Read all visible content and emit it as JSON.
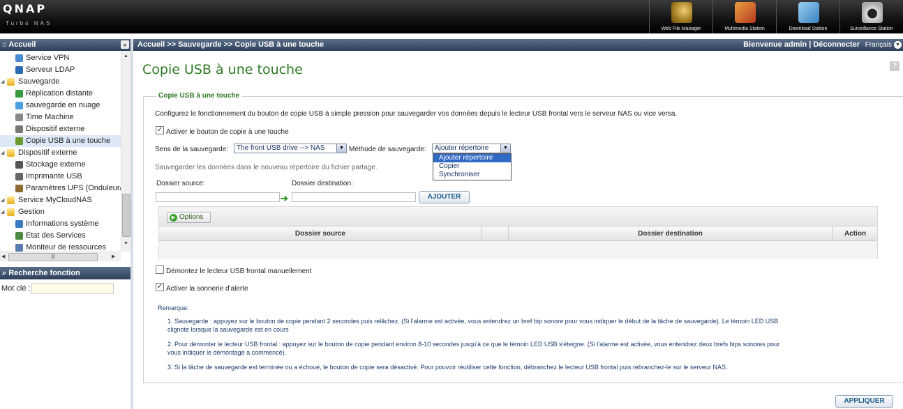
{
  "header": {
    "logo": "QNAP",
    "logo_sub": "Turbo NAS",
    "apps": [
      {
        "label": "Web File Manager",
        "icon": "web-file-manager-icon"
      },
      {
        "label": "Multimedia Station",
        "icon": "multimedia-station-icon"
      },
      {
        "label": "Download Station",
        "icon": "download-station-icon"
      },
      {
        "label": "Surveillance Station",
        "icon": "surveillance-station-icon"
      }
    ]
  },
  "sidebar": {
    "title": "Accueil",
    "collapse_glyph": "«",
    "items": [
      {
        "label": "Service VPN",
        "level": 2
      },
      {
        "label": "Serveur LDAP",
        "level": 2
      },
      {
        "label": "Sauvegarde",
        "level": 1
      },
      {
        "label": "Réplication distante",
        "level": 2
      },
      {
        "label": "sauvegarde en nuage",
        "level": 2
      },
      {
        "label": "Time Machine",
        "level": 2
      },
      {
        "label": "Dispositif externe",
        "level": 2
      },
      {
        "label": "Copie USB à une touche",
        "level": 2,
        "selected": true
      },
      {
        "label": "Dispositif externe",
        "level": 1
      },
      {
        "label": "Stockage externe",
        "level": 2
      },
      {
        "label": "Imprimante USB",
        "level": 2
      },
      {
        "label": "Paramètres UPS (Onduleur/A",
        "level": 2
      },
      {
        "label": "Service MyCloudNAS",
        "level": 1
      },
      {
        "label": "Gestion",
        "level": 1
      },
      {
        "label": "Informations système",
        "level": 2
      },
      {
        "label": "Etat des Services",
        "level": 2
      },
      {
        "label": "Moniteur de ressources",
        "level": 2
      }
    ],
    "search_title": "Recherche fonction",
    "search_label": "Mot clé :",
    "search_value": ""
  },
  "crumb": {
    "path": "Accueil >> Sauvegarde >> Copie USB à une touche",
    "welcome": "Bienvenue admin | Déconnecter",
    "language": "Français"
  },
  "main": {
    "title": "Copie USB à une touche",
    "help": "?",
    "legend": "Copie USB à une touche",
    "description": "Configurez le fonctionnement du bouton de copie USB à simple pression pour sauvegarder vos données depuis le lecteur USB frontal vers le serveur NAS ou vice versa.",
    "enable_label": "Activer le bouton de copie à une touche",
    "direction_label": "Sens de la sauvegarde:",
    "direction_value": "The front USB drive --> NAS",
    "method_label": "Méthode de sauvegarde:",
    "method_value": "Ajouter répertoire",
    "method_options": [
      "Ajouter répertoire",
      "Copier",
      "Synchroniser"
    ],
    "method_hint": "Sauvegarder les données dans le nouveau répertoire du fichier partage.",
    "source_label": "Dossier source:",
    "dest_label": "Dossier destination:",
    "source_value": "",
    "dest_value": "",
    "add_button": "AJOUTER",
    "options_button": "Options",
    "table_headers": [
      "Dossier source",
      "",
      "Dossier destination",
      "Action"
    ],
    "unmount_label": "Démontez le lecteur USB frontal manuellement",
    "alarm_label": "Activer la sonnerie d'alerte",
    "remark_title": "Remarque:",
    "remarks": [
      "1. Sauvegarde : appuyez sur le bouton de copie pendant 2 secondes puis relâchez. (Si l'alarme est activée, vous entendrez un bref bip sonore pour vous indiquer le début de la tâche de sauvegarde). Le témoin LED USB",
      "clignote lorsque la sauvegarde est en cours",
      "2. Pour démonter le lecteur USB frontal : appuyez sur le bouton de copie pendant environ 8-10 secondes jusqu'à ce que le témoin LED USB s'éteigne. (Si l'alarme est activée, vous entendrez deux brefs bips sonores pour",
      "vous indiquer le démontage a commencé).",
      "3. Si la tâche de sauvegarde est terminée ou a échoué, le bouton de copie sera désactivé. Pour pouvoir réutiliser cette fonction, débranchez le lecteur USB frontal puis rebranchez-le sur le serveur NAS."
    ],
    "apply_button": "APPLIQUER"
  },
  "colors": {
    "accent_green": "#2f7a25",
    "nav_blue": "#2d3e58",
    "selection": "#316ac5"
  }
}
